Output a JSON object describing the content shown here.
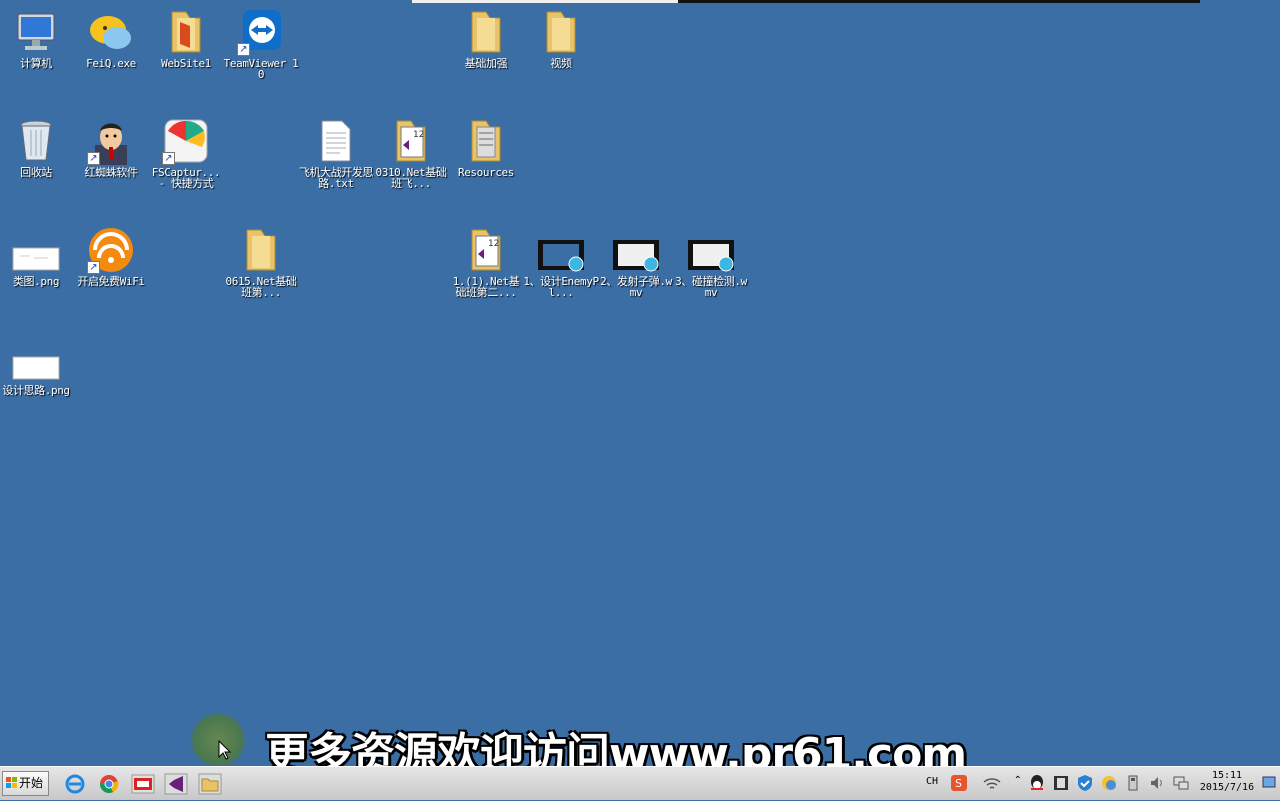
{
  "desktop": {
    "icons": [
      {
        "name": "computer-icon",
        "label": "计算机"
      },
      {
        "name": "feiq-icon",
        "label": "FeiQ.exe"
      },
      {
        "name": "website1-folder-icon",
        "label": "WebSite1"
      },
      {
        "name": "teamviewer-icon",
        "label": "TeamViewer 10"
      },
      {
        "name": "folder-basic-enhance-icon",
        "label": "基础加强"
      },
      {
        "name": "folder-video-icon",
        "label": "视频"
      },
      {
        "name": "recycle-bin-icon",
        "label": "回收站"
      },
      {
        "name": "red-spider-icon",
        "label": "红蜘蛛软件"
      },
      {
        "name": "fscapture-icon",
        "label": "FSCaptur... - 快捷方式"
      },
      {
        "name": "text-file-icon",
        "label": "飞机大战开发思路.txt"
      },
      {
        "name": "vs-folder-0310-icon",
        "label": "0310.Net基础班飞..."
      },
      {
        "name": "folder-resources-icon",
        "label": "Resources"
      },
      {
        "name": "png-class-diagram-icon",
        "label": "类图.png"
      },
      {
        "name": "free-wifi-icon",
        "label": "开启免费WiFi"
      },
      {
        "name": "folder-0615-icon",
        "label": "0615.Net基础班第..."
      },
      {
        "name": "vs-folder-1-icon",
        "label": "1.(1).Net基础班第二..."
      },
      {
        "name": "video-1-icon",
        "label": "1、设计EnemyPl..."
      },
      {
        "name": "video-2-icon",
        "label": "2、发射子弹.wmv"
      },
      {
        "name": "video-3-icon",
        "label": "3、碰撞检测.wmv"
      },
      {
        "name": "png-design-icon",
        "label": "设计思路.png"
      }
    ]
  },
  "taskbar": {
    "start_label": "开始",
    "language": "CH",
    "time": "15:11",
    "date": "2015/7/16"
  },
  "overlay": {
    "banner_text": "更多资源欢迎访问www.pr61.com"
  }
}
